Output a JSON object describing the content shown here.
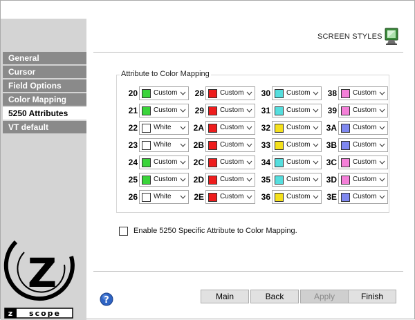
{
  "header": {
    "title": "SCREEN STYLES",
    "icon": "monitor-icon"
  },
  "sidebar": {
    "items": [
      {
        "label": "General",
        "active": false
      },
      {
        "label": "Cursor",
        "active": false
      },
      {
        "label": "Field Options",
        "active": false
      },
      {
        "label": "Color Mapping",
        "active": false
      },
      {
        "label": "5250 Attributes",
        "active": true
      },
      {
        "label": "VT default",
        "active": false
      }
    ],
    "logo_text": "zscope"
  },
  "mapping": {
    "title": "Attribute to Color Mapping",
    "columns": [
      [
        {
          "code": "20",
          "color": "#3ad43a",
          "label": "Custom"
        },
        {
          "code": "21",
          "color": "#3ad43a",
          "label": "Custom"
        },
        {
          "code": "22",
          "color": "#ffffff",
          "label": "White"
        },
        {
          "code": "23",
          "color": "#ffffff",
          "label": "White"
        },
        {
          "code": "24",
          "color": "#3ad43a",
          "label": "Custom"
        },
        {
          "code": "25",
          "color": "#3ad43a",
          "label": "Custom"
        },
        {
          "code": "26",
          "color": "#ffffff",
          "label": "White"
        }
      ],
      [
        {
          "code": "28",
          "color": "#ee1c1c",
          "label": "Custom"
        },
        {
          "code": "29",
          "color": "#ee1c1c",
          "label": "Custom"
        },
        {
          "code": "2A",
          "color": "#ee1c1c",
          "label": "Custom"
        },
        {
          "code": "2B",
          "color": "#ee1c1c",
          "label": "Custom"
        },
        {
          "code": "2C",
          "color": "#ee1c1c",
          "label": "Custom"
        },
        {
          "code": "2D",
          "color": "#ee1c1c",
          "label": "Custom"
        },
        {
          "code": "2E",
          "color": "#ee1c1c",
          "label": "Custom"
        }
      ],
      [
        {
          "code": "30",
          "color": "#55dede",
          "label": "Custom"
        },
        {
          "code": "31",
          "color": "#55dede",
          "label": "Custom"
        },
        {
          "code": "32",
          "color": "#f4e01c",
          "label": "Custom"
        },
        {
          "code": "33",
          "color": "#f4e01c",
          "label": "Custom"
        },
        {
          "code": "34",
          "color": "#55dede",
          "label": "Custom"
        },
        {
          "code": "35",
          "color": "#55dede",
          "label": "Custom"
        },
        {
          "code": "36",
          "color": "#f4e01c",
          "label": "Custom"
        }
      ],
      [
        {
          "code": "38",
          "color": "#f47fd8",
          "label": "Custom"
        },
        {
          "code": "39",
          "color": "#f47fd8",
          "label": "Custom"
        },
        {
          "code": "3A",
          "color": "#7f88f0",
          "label": "Custom"
        },
        {
          "code": "3B",
          "color": "#7f88f0",
          "label": "Custom"
        },
        {
          "code": "3C",
          "color": "#f47fd8",
          "label": "Custom"
        },
        {
          "code": "3D",
          "color": "#f47fd8",
          "label": "Custom"
        },
        {
          "code": "3E",
          "color": "#7f88f0",
          "label": "Custom"
        }
      ]
    ]
  },
  "option": {
    "label": "Enable 5250 Specific Attribute to Color Mapping.",
    "checked": false
  },
  "footer": {
    "help_icon": "help-icon",
    "buttons": [
      {
        "label": "Main",
        "enabled": true
      },
      {
        "label": "Back",
        "enabled": true
      },
      {
        "label": "Apply",
        "enabled": false
      },
      {
        "label": "Finish",
        "enabled": true
      }
    ]
  }
}
